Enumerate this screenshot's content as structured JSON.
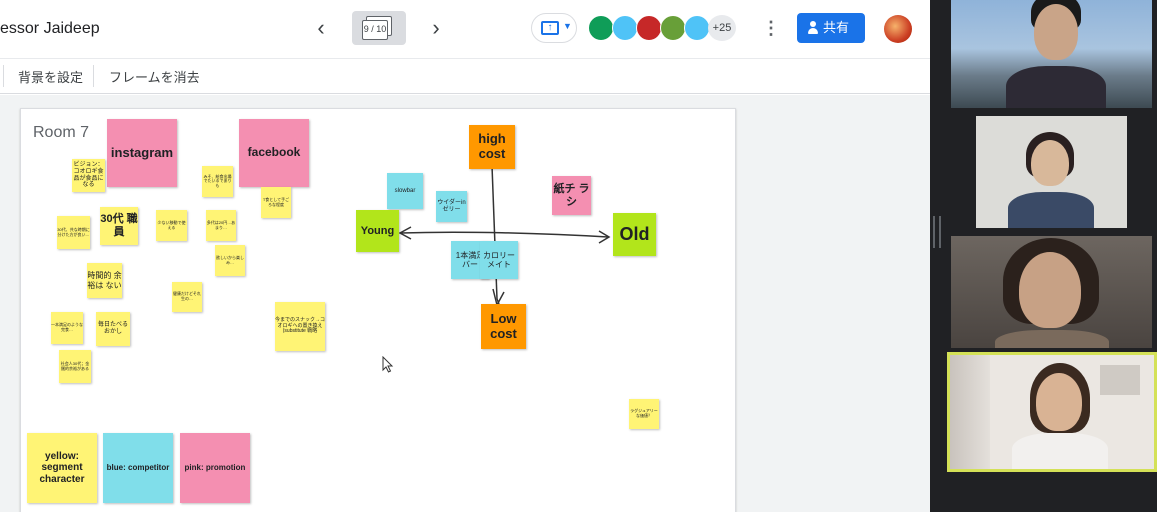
{
  "topbar": {
    "title": "essor Jaideep",
    "prev_icon": "chevron-left-icon",
    "next_icon": "chevron-right-icon",
    "frame_counter": "9 / 10",
    "present_icon": "present-to-screen-icon",
    "more_participants": "+25",
    "more_icon": "more-vert-icon",
    "share_label": "共有",
    "participants": [
      {
        "color": "#0f9d58"
      },
      {
        "color": "#4fc3f7"
      },
      {
        "color": "#c62828"
      },
      {
        "color": "#689f38"
      },
      {
        "color": "#4fc3f7"
      }
    ]
  },
  "toolbar": {
    "set_background": "背景を設定",
    "clear_frame": "フレームを消去"
  },
  "board": {
    "room_label": "Room 7",
    "notes": {
      "instagram": "instagram",
      "facebook": "facebook",
      "vision": "ビジョン：コオロギ食品が食品になる",
      "thirties_age": "30代、共な時期に分けた方が良い…",
      "thirties_staff": "30代 職員",
      "hardly_use": "少ない移動で使える",
      "miso": "みそ、給食出場でたいるでありも",
      "snack": "T食として手ごろな程度",
      "twenty_cost": "多代は20円…あまり…",
      "want_enjoy": "欲しいから楽しみ…",
      "time_margin": "時間的 余裕は ない",
      "health": "健康だけどそれ生の…",
      "one_stick": "一本満足のような完食…",
      "daily_eat": "毎日たべるおかし",
      "worker_30s": "社会人30代；金銭的余裕がある",
      "until_now": "今までのスナック→コオロギへの置き換え (substitute 戦略",
      "slowbar": "slowbar",
      "weider": "ウイダーin ゼリー",
      "one_bar": "1本満足 バー",
      "calorie_mate": "カロリーメイト",
      "high_cost": "high cost",
      "low_cost": "Low cost",
      "young": "Young",
      "old": "Old",
      "flyer": "紙チ ラシ",
      "luxury": "ラグジュアリーな価値？",
      "legend_yellow": "yellow: segment character",
      "legend_blue": "blue: competitor",
      "legend_pink": "pink: promotion"
    }
  },
  "video_tiles": [
    {
      "name": "participant-1",
      "bg": "#7a8fa6"
    },
    {
      "name": "participant-2",
      "bg": "#d9d9d6"
    },
    {
      "name": "participant-3",
      "bg": "#5b5550"
    },
    {
      "name": "participant-4-active",
      "bg": "#eae6e1",
      "highlight": "#d4e157"
    }
  ]
}
